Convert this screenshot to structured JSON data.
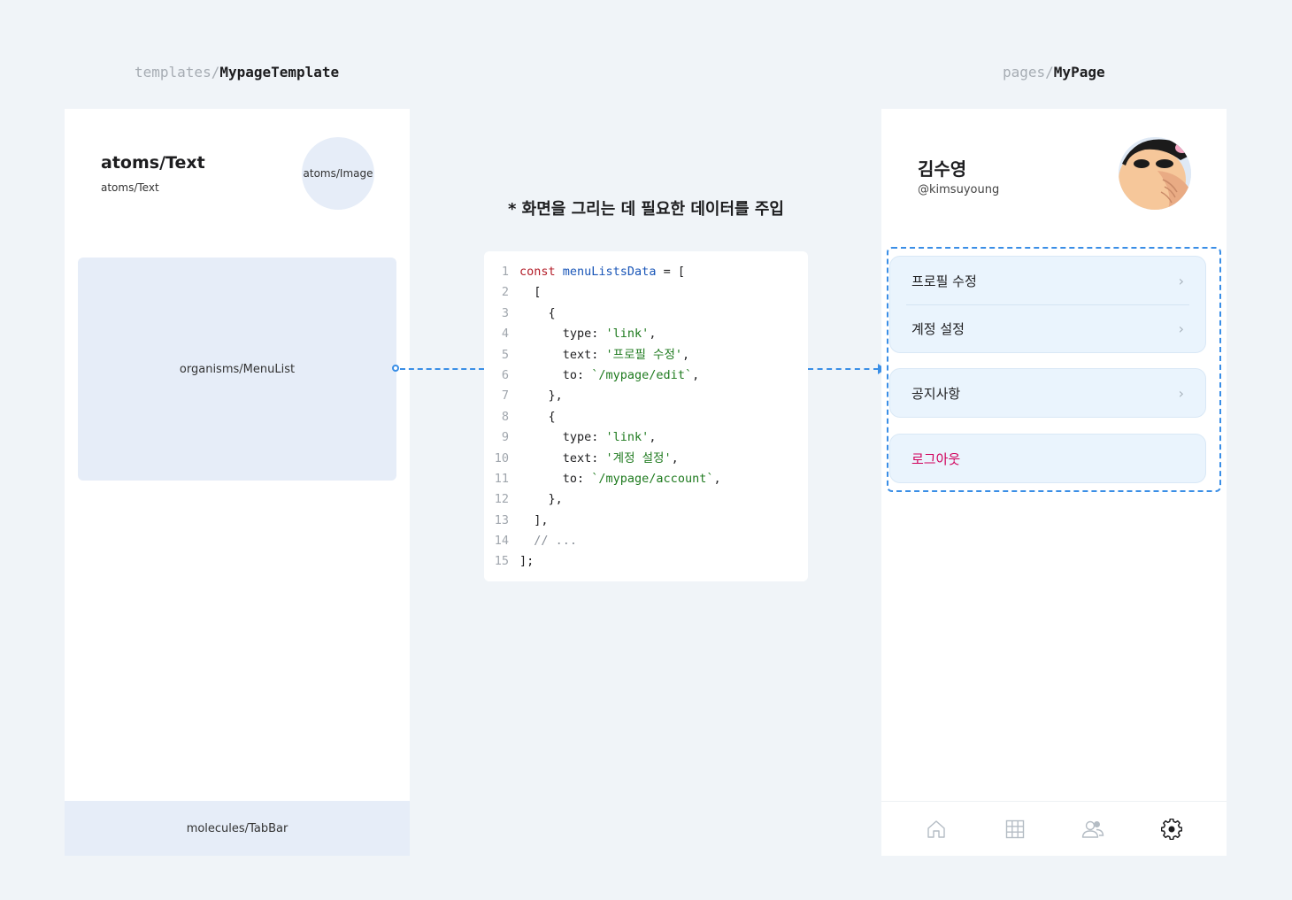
{
  "template": {
    "path_prefix": "templates/",
    "path_name": "MypageTemplate",
    "title_label": "atoms/Text",
    "subtitle_label": "atoms/Text",
    "image_label": "atoms/Image",
    "menulist_label": "organisms/MenuList",
    "tabbar_label": "molecules/TabBar"
  },
  "caption": "* 화면을 그리는 데 필요한 데이터를 주입",
  "code": {
    "line_numbers": [
      "1",
      "2",
      "3",
      "4",
      "5",
      "6",
      "7",
      "8",
      "9",
      "10",
      "11",
      "12",
      "13",
      "14",
      "15"
    ],
    "l1_kw": "const",
    "l1_var": "menuListsData",
    "l1_rest": " = [",
    "l2": "  [",
    "l3": "    {",
    "l4_key": "      type: ",
    "l4_val": "'link'",
    "l4_end": ",",
    "l5_key": "      text: ",
    "l5_val": "'프로필 수정'",
    "l5_end": ",",
    "l6_key": "      to: ",
    "l6_val": "`/mypage/edit`",
    "l6_end": ",",
    "l7": "    },",
    "l8": "    {",
    "l9_key": "      type: ",
    "l9_val": "'link'",
    "l9_end": ",",
    "l10_key": "      text: ",
    "l10_val": "'계정 설정'",
    "l10_end": ",",
    "l11_key": "      to: ",
    "l11_val": "`/mypage/account`",
    "l11_end": ",",
    "l12": "    },",
    "l13": "  ],",
    "l14": "  // ...",
    "l15": "];"
  },
  "page": {
    "path_prefix": "pages/",
    "path_name": "MyPage",
    "user_name": "김수영",
    "user_handle": "@kimsuyoung",
    "menu_group1": [
      "프로필 수정",
      "계정 설정"
    ],
    "menu_group2": [
      "공지사항"
    ],
    "logout_label": "로그아웃",
    "tab_icons": [
      "home-icon",
      "grid-icon",
      "users-icon",
      "gear-icon"
    ]
  },
  "colors": {
    "accent": "#3a8ee6",
    "logout": "#d1005b",
    "placeholder": "#e6edf8",
    "menu_bg": "#eaf4fd"
  }
}
